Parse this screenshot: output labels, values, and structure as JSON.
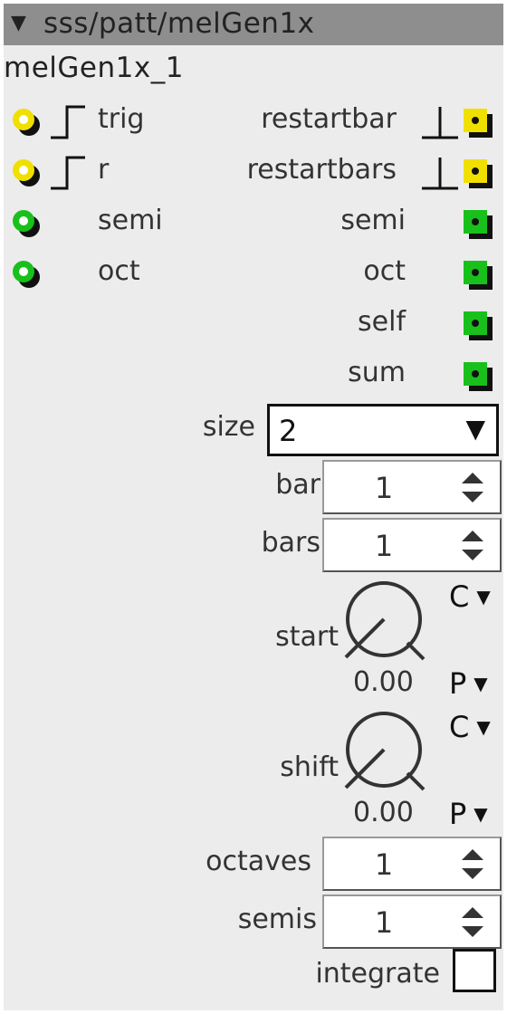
{
  "header": {
    "collapse_glyph": "▼",
    "title": "sss/patt/melGen1x"
  },
  "instance_name": "melGen1x_1",
  "inlets": [
    {
      "label": "trig",
      "type": "trigger"
    },
    {
      "label": "r",
      "type": "trigger"
    },
    {
      "label": "semi",
      "type": "frac"
    },
    {
      "label": "oct",
      "type": "frac"
    }
  ],
  "outlets": [
    {
      "label": "restartbar",
      "type": "trigger"
    },
    {
      "label": "restartbars",
      "type": "trigger"
    },
    {
      "label": "semi",
      "type": "frac"
    },
    {
      "label": "oct",
      "type": "frac"
    },
    {
      "label": "self",
      "type": "frac"
    },
    {
      "label": "sum",
      "type": "frac"
    }
  ],
  "size": {
    "label": "size",
    "value": "2",
    "arrow": "▼"
  },
  "bar": {
    "label": "bar",
    "value": "1"
  },
  "bars": {
    "label": "bars",
    "value": "1"
  },
  "start": {
    "label": "start",
    "value": "0.00",
    "mode_top": "C",
    "mode_bottom": "P",
    "arrow": "▼"
  },
  "shift": {
    "label": "shift",
    "value": "0.00",
    "mode_top": "C",
    "mode_bottom": "P",
    "arrow": "▼"
  },
  "octaves": {
    "label": "octaves",
    "value": "1"
  },
  "semis": {
    "label": "semis",
    "value": "1"
  },
  "integrate": {
    "label": "integrate",
    "checked": false
  },
  "colors": {
    "trigger_port": "#f0e000",
    "frac_port": "#19c01b",
    "title_bar": "#8e8e8e",
    "panel": "#ececec"
  }
}
